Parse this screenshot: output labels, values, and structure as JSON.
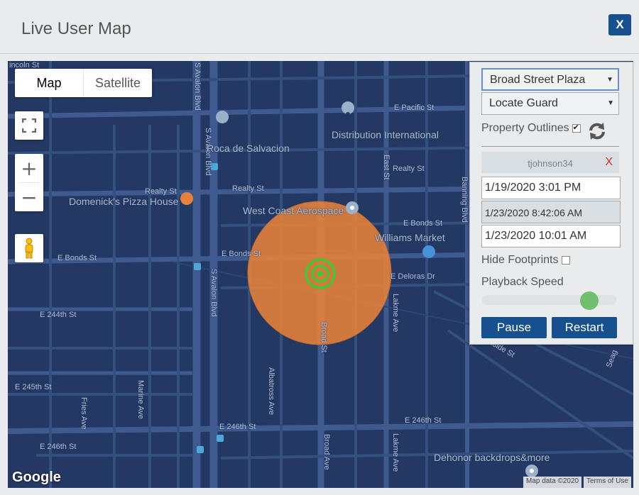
{
  "title": "Live User Map",
  "close_label": "X",
  "map": {
    "type_buttons": {
      "map": "Map",
      "satellite": "Satellite"
    },
    "zoom_in": "+",
    "zoom_out": "−",
    "logo": "Google",
    "attribution": "Map data ©2020",
    "terms": "Terms of Use",
    "streets": {
      "lincoln": "incoln St",
      "s_avalon_top": "S Avalon Blvd",
      "e_pacific": "E Pacific St",
      "s_avalon_mid": "S Avalon Blvd",
      "realty_1": "Realty St",
      "realty_2": "Realty St",
      "realty_3": "Realty St",
      "east_st": "East St",
      "banning": "Banning Blvd",
      "e_bonds_1": "E Bonds St",
      "e_bonds_2": "E Bonds St",
      "e_bonds_3": "E Bonds St",
      "s_avalon_low": "S Avalon Blvd",
      "e_deloras": "E Deloras Dr",
      "broad_st": "Broad St",
      "lakme_1": "Lakme Ave",
      "e_244th": "E 244th St",
      "e_245th": "E 245th St",
      "marine": "Marine Ave",
      "albatross": "Albatross Ave",
      "fries": "Fries Ave",
      "e_246th_1": "E 246th St",
      "e_246th_2": "E 246th St",
      "e_246th_3": "E 246th St",
      "broad_ave": "Broad Ave",
      "lakme_2": "Lakme Ave",
      "canside": "anside St",
      "seag": "Seag"
    },
    "pois": {
      "roca": "Roca de Salvacion",
      "distribution": "Distribution International",
      "dominick": "Domenick's Pizza House",
      "west_coast": "West Coast Aerospace",
      "williams": "Williams Market",
      "dehonor": "Dehonor backdrops&more"
    }
  },
  "panel": {
    "property_select": "Broad Street Plaza",
    "action_select": "Locate Guard",
    "property_outlines_label": "Property Outlines",
    "property_outlines_checked": true,
    "username": "tjohnson34",
    "remove_user": "X",
    "start_time": "1/19/2020 3:01 PM",
    "current_time": "1/23/2020 8:42:06 AM",
    "end_time": "1/23/2020 10:01 AM",
    "hide_footprints_label": "Hide Footprints",
    "hide_footprints_checked": false,
    "playback_speed_label": "Playback Speed",
    "playback_speed": 0.8,
    "pause_label": "Pause",
    "restart_label": "Restart"
  },
  "colors": {
    "accent": "#16508f",
    "map_bg": "#233862",
    "geofence": "#e8823a",
    "marker": "#2fd12f",
    "slider_thumb": "#71bf6e"
  }
}
